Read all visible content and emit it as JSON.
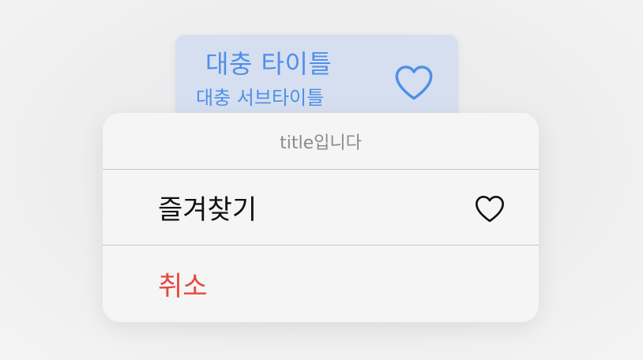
{
  "preview": {
    "title": "대충 타이틀",
    "subtitle": "대충 서브타이틀",
    "icon": "heart-outline-icon",
    "accent_color": "#4f8fe8",
    "background_color": "#d5dff0"
  },
  "action_sheet": {
    "title": "title입니다",
    "actions": [
      {
        "label": "즐겨찾기",
        "icon": "heart-outline-icon",
        "style": "default"
      },
      {
        "label": "취소",
        "style": "destructive",
        "color": "#e5483f"
      }
    ]
  }
}
